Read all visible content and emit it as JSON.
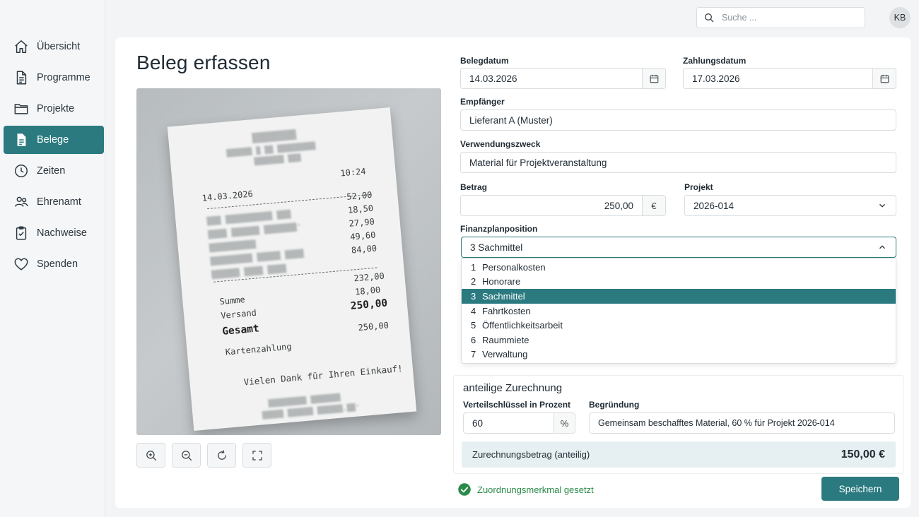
{
  "sidebar": {
    "items": [
      {
        "label": "Übersicht",
        "icon": "home-icon"
      },
      {
        "label": "Programme",
        "icon": "document-icon"
      },
      {
        "label": "Projekte",
        "icon": "folder-icon"
      },
      {
        "label": "Belege",
        "icon": "receipt-icon",
        "active": true
      },
      {
        "label": "Zeiten",
        "icon": "clock-icon"
      },
      {
        "label": "Ehrenamt",
        "icon": "people-icon"
      },
      {
        "label": "Nachweise",
        "icon": "clipboard-check-icon"
      },
      {
        "label": "Spenden",
        "icon": "heart-icon"
      }
    ]
  },
  "header": {
    "search_placeholder": "Suche ...",
    "avatar_initials": "KB"
  },
  "page": {
    "title": "Beleg erfassen"
  },
  "receipt": {
    "date": "14.03.2026",
    "time": "10:24",
    "items": [
      "52,00",
      "18,50",
      "27,90",
      "49,60",
      "84,00"
    ],
    "subtotal": "232,00",
    "shipping": "18,00",
    "total": "250,00",
    "paid": "250,00",
    "sum_label": "Summe",
    "shipping_label": "Versand",
    "total_label": "Gesamt",
    "payment_label": "Kartenzahlung",
    "thanks": "Vielen Dank für Ihren Einkauf!"
  },
  "form": {
    "belegdatum": {
      "label": "Belegdatum",
      "value": "14.03.2026"
    },
    "zahlungsdatum": {
      "label": "Zahlungsdatum",
      "value": "17.03.2026"
    },
    "empfaenger": {
      "label": "Empfänger",
      "value": "Lieferant A (Muster)"
    },
    "verwendungszweck": {
      "label": "Verwendungszweck",
      "value": "Material für Projektveranstaltung"
    },
    "betrag": {
      "label": "Betrag",
      "value": "250,00",
      "unit": "€"
    },
    "projekt": {
      "label": "Projekt",
      "value": "2026-014"
    },
    "finanzplan": {
      "label": "Finanzplanposition",
      "value": "3 Sachmittel",
      "options": [
        {
          "num": "1",
          "label": "Personalkosten"
        },
        {
          "num": "2",
          "label": "Honorare"
        },
        {
          "num": "3",
          "label": "Sachmittel",
          "selected": true
        },
        {
          "num": "4",
          "label": "Fahrtkosten"
        },
        {
          "num": "5",
          "label": "Öffentlichkeitsarbeit"
        },
        {
          "num": "6",
          "label": "Raummiete"
        },
        {
          "num": "7",
          "label": "Verwaltung"
        }
      ]
    }
  },
  "allocation": {
    "title": "anteilige Zurechnung",
    "key_label": "Verteilschlüssel in Prozent",
    "key_value": "60",
    "key_unit": "%",
    "reason_label": "Begründung",
    "reason_value": "Gemeinsam beschafftes Material, 60 % für Projekt 2026-014",
    "sum_label": "Zurechnungsbetrag (anteilig)",
    "sum_value": "150,00 €"
  },
  "status": {
    "text": "Zuordnungsmerkmal gesetzt"
  },
  "actions": {
    "save_label": "Speichern"
  },
  "colors": {
    "accent": "#2a7a80",
    "success": "#2a8a4a"
  }
}
